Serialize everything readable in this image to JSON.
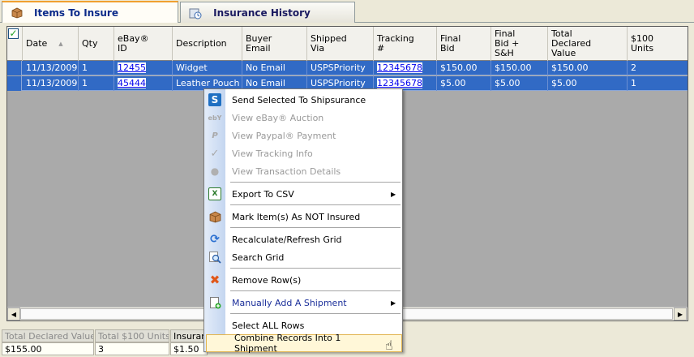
{
  "tabs": [
    {
      "label": "Items To Insure",
      "active": true
    },
    {
      "label": "Insurance History",
      "active": false
    }
  ],
  "grid": {
    "columns": [
      "Date",
      "Qty",
      "eBay®\nID",
      "Description",
      "Buyer\nEmail",
      "Shipped\nVia",
      "Tracking\n#",
      "Final\nBid",
      "Final\nBid +\nS&H",
      "Total\nDeclared\nValue",
      "$100\nUnits"
    ],
    "rows": [
      {
        "date": "11/13/2009",
        "qty": "1",
        "ebay_id": "12455",
        "description": "Widget",
        "buyer_email": "No Email",
        "shipped_via": "USPSPriority",
        "tracking": "12345678",
        "final_bid": "$150.00",
        "final_bid_sh": "$150.00",
        "total_declared": "$150.00",
        "units": "2"
      },
      {
        "date": "11/13/2009",
        "qty": "1",
        "ebay_id": "45444",
        "description": "Leather Pouch",
        "buyer_email": "No Email",
        "shipped_via": "USPSPriority",
        "tracking": "12345678",
        "final_bid": "$5.00",
        "final_bid_sh": "$5.00",
        "total_declared": "$5.00",
        "units": "1"
      }
    ]
  },
  "footer": {
    "labels": [
      "Total Declared Value:",
      "Total $100 Units",
      "Insurance"
    ],
    "values": [
      "$155.00",
      "3",
      "$1.50"
    ]
  },
  "context_menu": {
    "items": [
      {
        "label": "Send Selected To Shipsurance",
        "icon": "shipsurance-icon",
        "enabled": true
      },
      {
        "label": "View eBay® Auction",
        "icon": "ebay-icon",
        "enabled": false
      },
      {
        "label": "View Paypal® Payment",
        "icon": "paypal-icon",
        "enabled": false
      },
      {
        "label": "View Tracking Info",
        "icon": "checkmark-icon",
        "enabled": false
      },
      {
        "label": "View Transaction Details",
        "icon": "details-icon",
        "enabled": false
      },
      {
        "label": "Export To CSV",
        "icon": "excel-icon",
        "enabled": true,
        "submenu": true
      },
      {
        "label": "Mark Item(s) As NOT Insured",
        "icon": "box-icon",
        "enabled": true
      },
      {
        "label": "Recalculate/Refresh Grid",
        "icon": "refresh-icon",
        "enabled": true
      },
      {
        "label": "Search Grid",
        "icon": "search-icon",
        "enabled": true
      },
      {
        "label": "Remove Row(s)",
        "icon": "remove-icon",
        "enabled": true
      },
      {
        "label": "Manually Add A Shipment",
        "icon": "add-shipment-icon",
        "enabled": true,
        "submenu": true
      },
      {
        "label": "Select ALL Rows",
        "icon": "",
        "enabled": true
      },
      {
        "label": "Combine Records Into 1 Shipment",
        "icon": "",
        "enabled": true,
        "highlighted": true
      }
    ]
  },
  "colors": {
    "selection": "#316ac5",
    "menu_highlight": "#fff7d8",
    "tab_accent": "#f0a030"
  }
}
